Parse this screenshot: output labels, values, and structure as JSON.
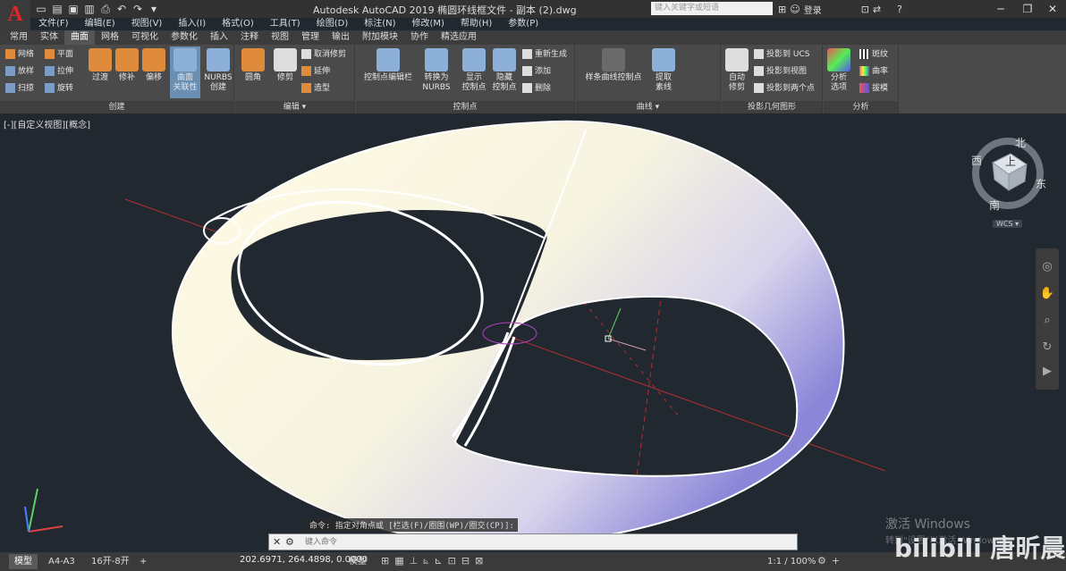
{
  "window": {
    "title": "Autodesk AutoCAD 2019    椭圆环线框文件 - 副本 (2).dwg",
    "search_placeholder": "键入关键字或短语",
    "login": "登录",
    "help": "?",
    "minimize": "─",
    "restore": "❐",
    "close": "✕"
  },
  "menu": [
    "文件(F)",
    "编辑(E)",
    "视图(V)",
    "插入(I)",
    "格式(O)",
    "工具(T)",
    "绘图(D)",
    "标注(N)",
    "修改(M)",
    "帮助(H)",
    "参数(P)"
  ],
  "tabs": [
    "常用",
    "实体",
    "曲面",
    "网格",
    "可视化",
    "参数化",
    "插入",
    "注释",
    "视图",
    "管理",
    "输出",
    "附加模块",
    "协作",
    "精选应用"
  ],
  "active_tab": "曲面",
  "panels": {
    "create": {
      "title": "创建",
      "small": [
        "网络",
        "平面",
        "放样",
        "拉伸",
        "扫掠",
        "旋转"
      ],
      "large": [
        "过渡",
        "修补",
        "偏移",
        "曲面\n关联性",
        "NURBS\n创建"
      ]
    },
    "edit": {
      "title": "编辑 ▾",
      "large": [
        "圆角",
        "修剪"
      ],
      "small": [
        "取消修剪",
        "延伸",
        "造型"
      ]
    },
    "controlpoints": {
      "title": "控制点",
      "large": [
        "控制点编辑栏",
        "转换为\nNURBS",
        "显示\n控制点",
        "隐藏\n控制点"
      ],
      "small": [
        "重新生成",
        "添加",
        "删除"
      ]
    },
    "curves": {
      "title": "曲线 ▾",
      "large": [
        "样条曲线控制点",
        "提取\n素线"
      ]
    },
    "projection": {
      "title": "投影几何图形",
      "large": [
        "自动\n修剪"
      ],
      "small": [
        "投影到 UCS",
        "投影到视图",
        "投影到两个点"
      ]
    },
    "analysis": {
      "title": "分析",
      "large": [
        "分析\n选项"
      ],
      "small": [
        "斑纹",
        "曲率",
        "拔模"
      ]
    }
  },
  "viewport": {
    "label": "[-][自定义视图][概念]"
  },
  "viewcube": {
    "top": "上",
    "north": "北",
    "south": "南",
    "east": "东",
    "west": "西",
    "wcs": "WCS ▾"
  },
  "command": {
    "history": "命令: 指定对角点或 [栏选(F)/圈围(WP)/圈交(CP)]:",
    "placeholder": "键入命令"
  },
  "status": {
    "tabs": [
      "模型",
      "A4-A3",
      "16开-8开"
    ],
    "add_tab": "+",
    "coords": "202.6971, 264.4898, 0.0000",
    "model": "模型",
    "scale": "1:1 / 100%"
  },
  "watermark": {
    "line1": "激活 Windows",
    "line2": "转到\"设置\"以激活 Windows。",
    "brand": "bilibili 唐昕晨"
  }
}
